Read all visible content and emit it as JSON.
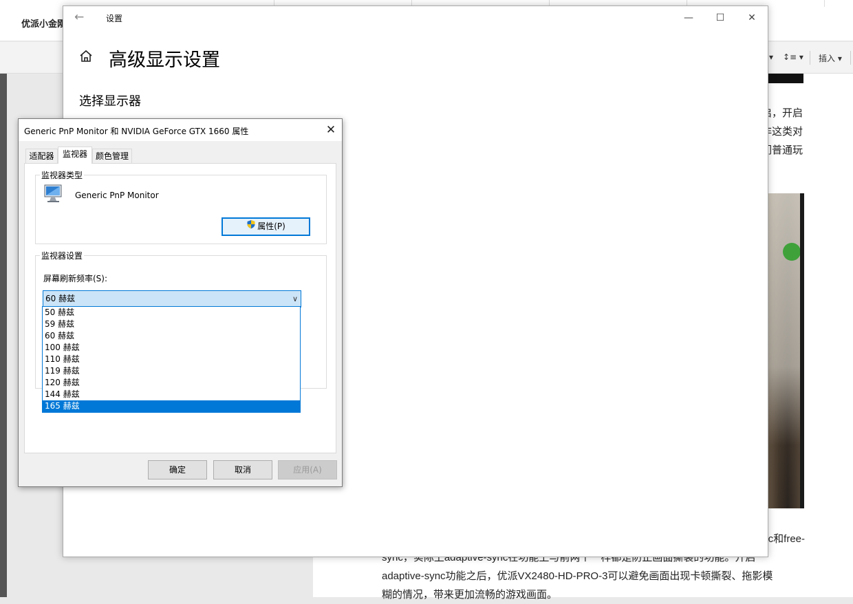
{
  "background_app": {
    "title": "优派小金刚",
    "toolbar_items": [
      "↕≡ ▾",
      "插入 ▾"
    ],
    "paragraph_fragments": [
      "启，开启",
      "非这类对",
      "们普通玩"
    ],
    "footer_lines": [
      "c和free-",
      "sync，实际上adaptive-sync在功能上与前两个一样都是防止画面撕裂的功能。开启",
      "adaptive-sync功能之后，优派VX2480-HD-PRO-3可以避免画面出现卡顿撕裂、拖影模",
      "糊的情况，带来更加流畅的游戏画面。"
    ]
  },
  "settings_window": {
    "back_icon": "back-arrow-icon",
    "title": "设置",
    "controls": {
      "minimize": "—",
      "maximize": "☐",
      "close": "✕"
    },
    "home_icon": "home-icon",
    "heading": "高级显示设置",
    "subheading": "选择显示器"
  },
  "properties_dialog": {
    "title": "Generic PnP Monitor 和 NVIDIA GeForce GTX 1660 属性",
    "close": "✕",
    "tabs": [
      {
        "label": "适配器",
        "active": false
      },
      {
        "label": "监视器",
        "active": true
      },
      {
        "label": "颜色管理",
        "active": false
      }
    ],
    "monitor_type": {
      "group_label": "监视器类型",
      "icon": "monitor-icon",
      "name": "Generic PnP Monitor",
      "properties_button": "属性(P)",
      "shield_icon": "uac-shield-icon"
    },
    "monitor_settings": {
      "group_label": "监视器设置",
      "refresh_label": "屏幕刷新频率(S):",
      "selected_value": "60 赫兹",
      "options": [
        "50 赫兹",
        "59 赫兹",
        "60 赫兹",
        "100 赫兹",
        "110 赫兹",
        "119 赫兹",
        "120 赫兹",
        "144 赫兹",
        "165 赫兹"
      ],
      "highlighted_option": "165 赫兹"
    },
    "buttons": {
      "ok": "确定",
      "cancel": "取消",
      "apply": "应用(A)"
    },
    "colors": {
      "accent": "#0078d7",
      "selection_bg": "#cce4f7"
    }
  }
}
